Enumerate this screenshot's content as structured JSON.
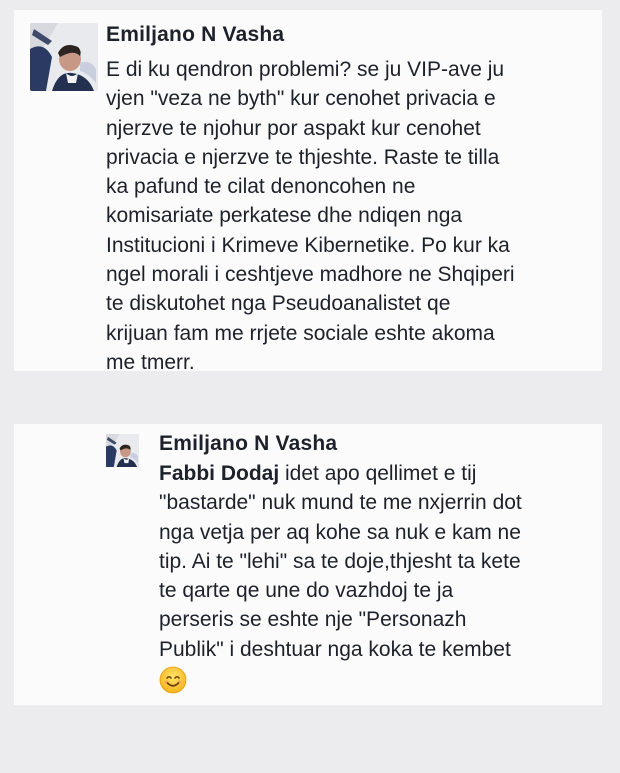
{
  "comments": [
    {
      "author": "Emiljano N Vasha",
      "avatar_icon": "profile-photo-avatar",
      "lines": [
        "E di ku qendron problemi? se ju VIP-ave ju",
        "vjen \"veza ne byth\" kur cenohet privacia e",
        "njerzve te njohur por aspakt kur cenohet",
        "privacia e njerzve te thjeshte. Raste te tilla",
        "ka pafund te cilat denoncohen ne",
        "komisariate perkatese dhe ndiqen nga",
        "Institucioni i Krimeve Kibernetike. Po kur ka",
        "ngel morali i ceshtjeve madhore ne Shqiperi",
        "te diskutohet nga Pseudoanalistet qe",
        "krijuan fam me rrjete sociale eshte akoma",
        "me tmerr."
      ]
    },
    {
      "author": "Emiljano N Vasha",
      "avatar_icon": "profile-photo-avatar",
      "mention": "Fabbi Dodaj",
      "first_line_rest": " idet apo qellimet e tij",
      "lines": [
        "\"bastarde\" nuk mund te me nxjerrin dot",
        "nga vetja per aq kohe sa nuk e kam ne",
        "tip. Ai te \"lehi\" sa te doje,thjesht ta kete",
        "te qarte qe une do vazhdoj te ja",
        "perseris se eshte nje \"Personazh",
        "Publik\" i deshtuar nga koka te kembet"
      ],
      "emoji_icon": "smiling-face-emoji-icon"
    }
  ],
  "colors": {
    "background": "#ececee",
    "card": "#fbfbfc",
    "text": "#1d2129"
  }
}
